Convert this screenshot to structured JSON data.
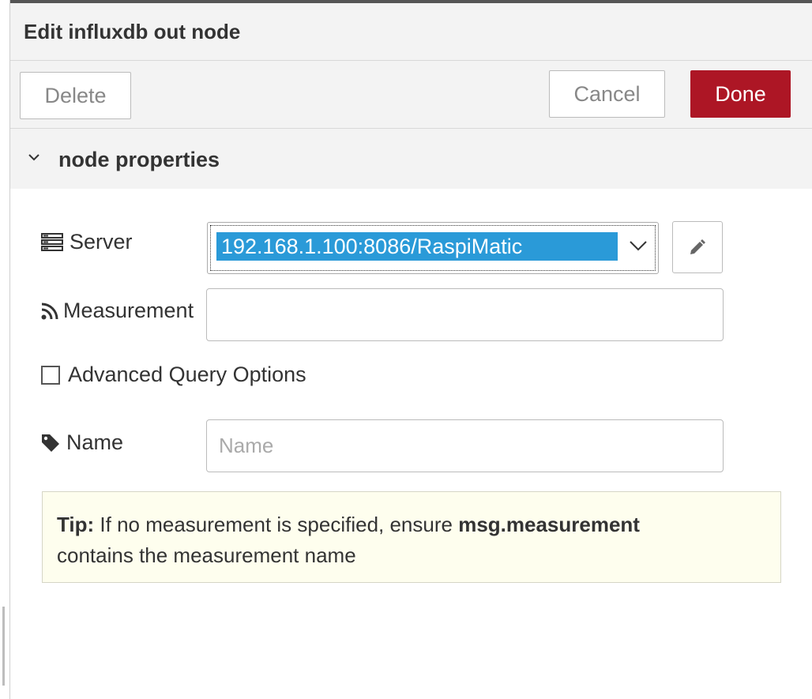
{
  "dialog": {
    "title": "Edit influxdb out node"
  },
  "toolbar": {
    "delete_label": "Delete",
    "cancel_label": "Cancel",
    "done_label": "Done"
  },
  "section": {
    "title": "node properties"
  },
  "form": {
    "server_label": "Server",
    "server_value": "192.168.1.100:8086/RaspiMatic",
    "measurement_label": "Measurement",
    "measurement_value": "",
    "advanced_label": "Advanced Query Options",
    "advanced_checked": false,
    "name_label": "Name",
    "name_value": "",
    "name_placeholder": "Name"
  },
  "tip": {
    "prefix": "Tip:",
    "text1": " If no measurement is specified, ensure ",
    "code": "msg.measurement",
    "text2": "contains the measurement name"
  },
  "colors": {
    "done_bg": "#ad1625",
    "select_highlight": "#2a9ad8",
    "tip_bg": "#fefeee"
  }
}
